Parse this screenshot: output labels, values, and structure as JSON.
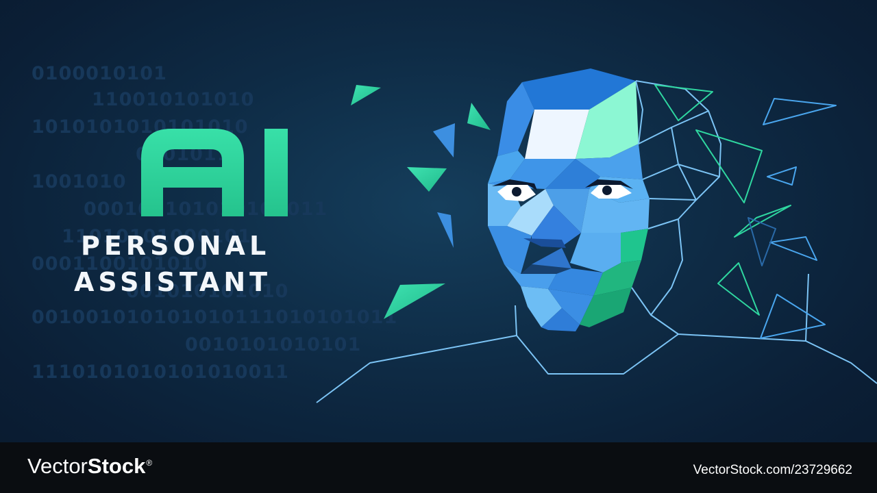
{
  "binary_lines": [
    "0100010101",
    "110010101010",
    "1010101010101010",
    "0101011",
    "1001010",
    "000101101010101011",
    "11010101000101",
    "0001100101010",
    "001010101010",
    "001001010101010111010101011",
    "0010101010101",
    "1110101010101010011"
  ],
  "headline": {
    "ai": "AI"
  },
  "subtitle": {
    "line1": "PERSONAL",
    "line2": "ASSISTANT"
  },
  "footer": {
    "logo_part1": "Vector",
    "logo_part2": "Stock",
    "logo_mark": "®",
    "url": "VectorStock.com/23729662"
  },
  "colors": {
    "background": "#0e2b45",
    "accent_green": "#2fd7a0",
    "accent_blue": "#4aa6ee",
    "outline": "#7cc4f5",
    "text": "#f2f6fa",
    "footer": "#0a0d11"
  }
}
